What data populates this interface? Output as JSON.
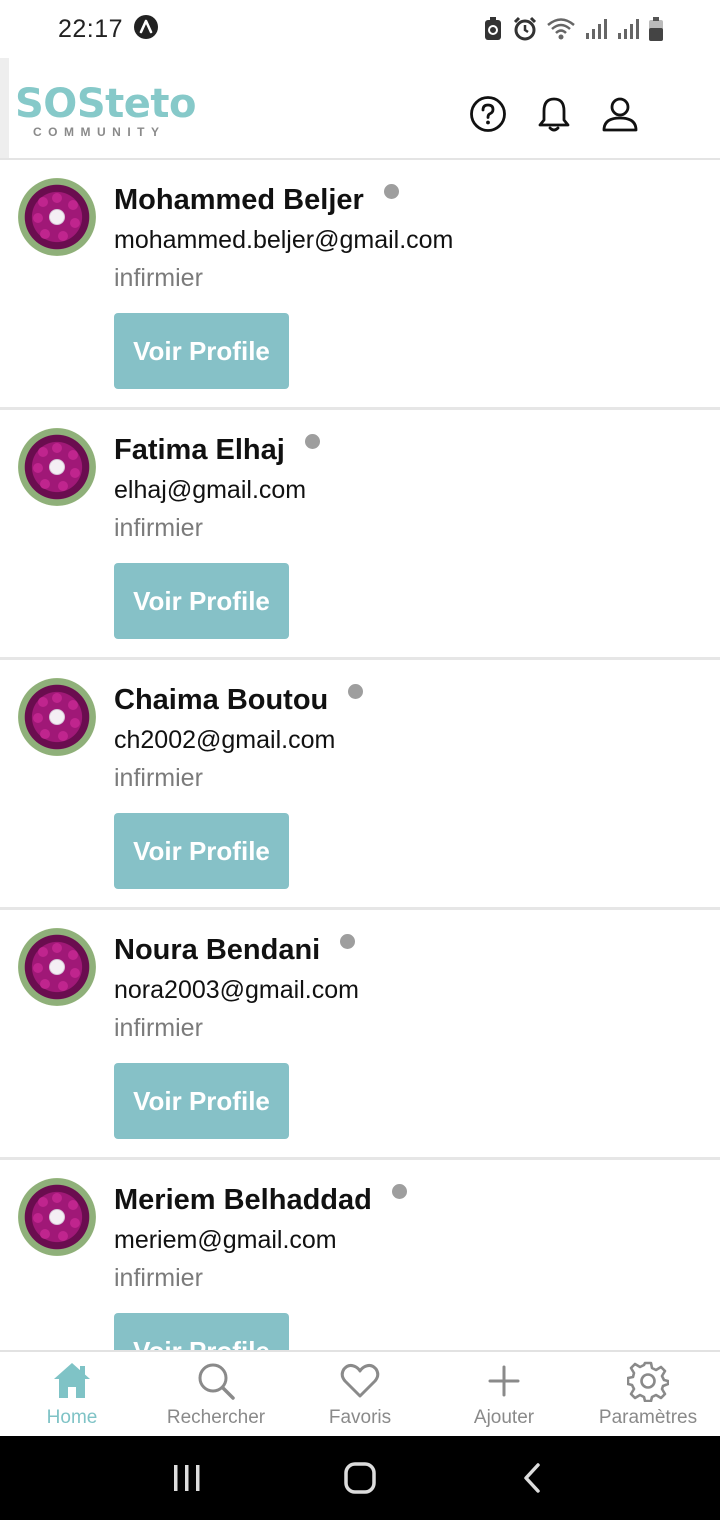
{
  "status_bar": {
    "time": "22:17"
  },
  "header": {
    "logo_text": "SOSteto",
    "logo_subtext": "COMMUNITY"
  },
  "users": [
    {
      "name": "Mohammed Beljer",
      "email": "mohammed.beljer@gmail.com",
      "role": "infirmier",
      "button": "Voir Profile"
    },
    {
      "name": "Fatima Elhaj",
      "email": "elhaj@gmail.com",
      "role": "infirmier",
      "button": "Voir Profile"
    },
    {
      "name": "Chaima Boutou",
      "email": "ch2002@gmail.com",
      "role": "infirmier",
      "button": "Voir Profile"
    },
    {
      "name": "Noura Bendani",
      "email": "nora2003@gmail.com",
      "role": "infirmier",
      "button": "Voir Profile"
    },
    {
      "name": "Meriem Belhaddad",
      "email": "meriem@gmail.com",
      "role": "infirmier",
      "button": "Voir Profile"
    }
  ],
  "bottom_nav": {
    "items": [
      {
        "label": "Home",
        "icon": "home-icon",
        "active": true
      },
      {
        "label": "Rechercher",
        "icon": "search-icon",
        "active": false
      },
      {
        "label": "Favoris",
        "icon": "heart-icon",
        "active": false
      },
      {
        "label": "Ajouter",
        "icon": "plus-icon",
        "active": false
      },
      {
        "label": "Paramètres",
        "icon": "gear-icon",
        "active": false
      }
    ]
  },
  "colors": {
    "accent": "#86c1c7",
    "logo": "#86c9c9",
    "status_dot": "#9e9e9e"
  }
}
